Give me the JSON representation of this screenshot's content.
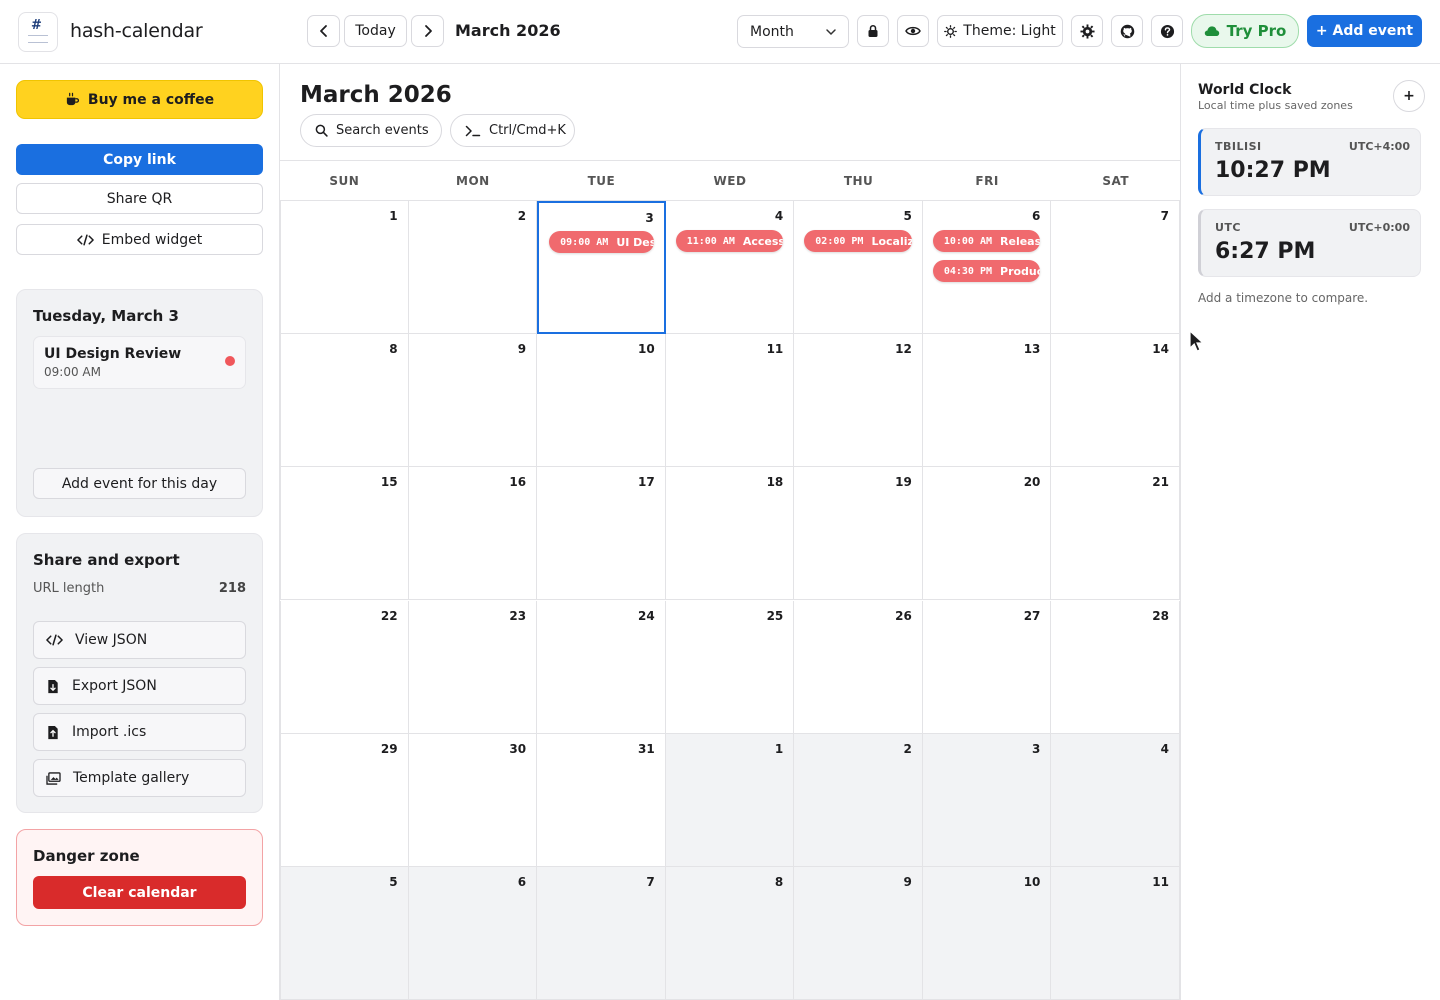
{
  "app": {
    "title": "hash-calendar",
    "logo_text": "#"
  },
  "toolbar": {
    "today_label": "Today",
    "month_label": "March 2026",
    "view_selected": "Month",
    "theme_label": "Theme: Light",
    "try_pro_label": "Try Pro",
    "add_event_label": "+ Add event"
  },
  "sidebar": {
    "coffee_label": "Buy me a coffee",
    "copy_link_label": "Copy link",
    "share_qr_label": "Share QR",
    "embed_label": "Embed widget",
    "day_panel": {
      "title": "Tuesday, March 3",
      "event_title": "UI Design Review",
      "event_time": "09:00 AM",
      "add_label": "Add event for this day"
    },
    "share_panel": {
      "title": "Share and export",
      "url_length_label": "URL length",
      "url_length_value": "218",
      "buttons": [
        "View JSON",
        "Export JSON",
        "Import .ics",
        "Template gallery"
      ]
    },
    "danger": {
      "title": "Danger zone",
      "clear_label": "Clear calendar"
    }
  },
  "calendar": {
    "title": "March 2026",
    "search_label": "Search events",
    "command_label": "Ctrl/Cmd+K",
    "weekdays": [
      "SUN",
      "MON",
      "TUE",
      "WED",
      "THU",
      "FRI",
      "SAT"
    ],
    "weeks": [
      [
        "1",
        "2",
        "3",
        "4",
        "5",
        "6",
        "7"
      ],
      [
        "8",
        "9",
        "10",
        "11",
        "12",
        "13",
        "14"
      ],
      [
        "15",
        "16",
        "17",
        "18",
        "19",
        "20",
        "21"
      ],
      [
        "22",
        "23",
        "24",
        "25",
        "26",
        "27",
        "28"
      ],
      [
        "29",
        "30",
        "31",
        "1",
        "2",
        "3",
        "4"
      ],
      [
        "5",
        "6",
        "7",
        "8",
        "9",
        "10",
        "11"
      ]
    ],
    "selected_day": "3",
    "events": [
      {
        "day": "3",
        "time": "09:00 AM",
        "title": "UI Desi"
      },
      {
        "day": "4",
        "time": "11:00 AM",
        "title": "Access"
      },
      {
        "day": "5",
        "time": "02:00 PM",
        "title": "Localiz"
      },
      {
        "day": "6",
        "time": "10:00 AM",
        "title": "Releas"
      },
      {
        "day": "6",
        "time": "04:30 PM",
        "title": "Produc"
      }
    ],
    "event_color": "#f06a6e"
  },
  "world_clock": {
    "title": "World Clock",
    "subtitle": "Local time plus saved zones",
    "add_label": "+",
    "zones": [
      {
        "name": "TBILISI",
        "offset": "UTC+4:00",
        "time": "10:27 PM"
      },
      {
        "name": "UTC",
        "offset": "UTC+0:00",
        "time": "6:27 PM"
      }
    ],
    "hint": "Add a timezone to compare."
  },
  "colors": {
    "accent": "#1a6fe0",
    "coffee": "#ffd21f",
    "danger": "#d92b2b",
    "pro": "#1f8f3a"
  }
}
